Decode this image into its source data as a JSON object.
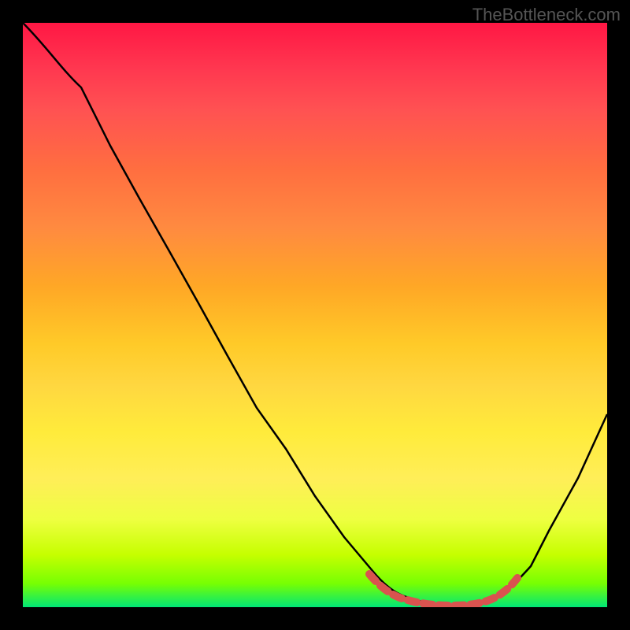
{
  "watermark": "TheBottleneck.com",
  "chart_data": {
    "type": "line",
    "title": "",
    "xlabel": "",
    "ylabel": "",
    "xlim": [
      0,
      100
    ],
    "ylim": [
      0,
      100
    ],
    "series": [
      {
        "name": "bottleneck-curve",
        "x": [
          0,
          5,
          10,
          15,
          20,
          25,
          30,
          35,
          40,
          45,
          50,
          55,
          60,
          63,
          67,
          70,
          73,
          77,
          80,
          83,
          87,
          90,
          95,
          100
        ],
        "values": [
          100,
          96,
          89,
          80,
          71,
          62,
          53,
          44,
          35,
          27,
          19,
          12,
          6,
          3,
          1,
          0,
          0,
          0,
          1,
          3,
          7,
          12,
          22,
          33
        ]
      }
    ],
    "optimal_range": {
      "x_start": 60,
      "x_end": 83,
      "description": "optimal-zone-marker"
    },
    "background_gradient": {
      "type": "vertical",
      "stops": [
        {
          "offset": 0,
          "color": "#ff1744"
        },
        {
          "offset": 50,
          "color": "#ffca28"
        },
        {
          "offset": 100,
          "color": "#00e676"
        }
      ]
    }
  }
}
